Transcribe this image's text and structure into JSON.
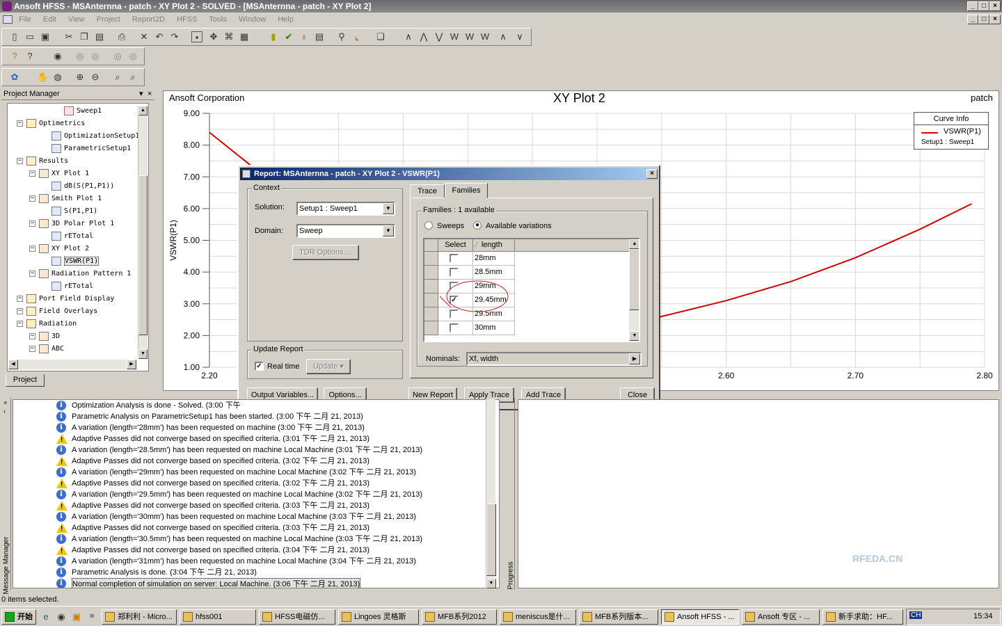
{
  "window": {
    "title": "Ansoft HFSS - MSAnternna - patch - XY Plot 2 - SOLVED - [MSAnternna - patch - XY Plot 2]"
  },
  "menu": [
    "File",
    "Edit",
    "View",
    "Project",
    "Report2D",
    "HFSS",
    "Tools",
    "Window",
    "Help"
  ],
  "project_manager": {
    "title": "Project Manager",
    "tab": "Project",
    "tree": [
      {
        "label": "Sweep1",
        "depth": 4
      },
      {
        "label": "Optimetrics",
        "depth": 1
      },
      {
        "label": "OptimizationSetup1",
        "depth": 3
      },
      {
        "label": "ParametricSetup1",
        "depth": 3
      },
      {
        "label": "Results",
        "depth": 1
      },
      {
        "label": "XY Plot 1",
        "depth": 2
      },
      {
        "label": "dB(S(P1,P1))",
        "depth": 3
      },
      {
        "label": "Smith Plot 1",
        "depth": 2
      },
      {
        "label": "S(P1,P1)",
        "depth": 3
      },
      {
        "label": "3D Polar Plot 1",
        "depth": 2
      },
      {
        "label": "rETotal",
        "depth": 3
      },
      {
        "label": "XY Plot 2",
        "depth": 2
      },
      {
        "label": "VSWR(P1)",
        "depth": 3
      },
      {
        "label": "Radiation Pattern 1",
        "depth": 2
      },
      {
        "label": "rETotal",
        "depth": 3
      },
      {
        "label": "Port Field Display",
        "depth": 1
      },
      {
        "label": "Field Overlays",
        "depth": 1
      },
      {
        "label": "Radiation",
        "depth": 1
      },
      {
        "label": "3D",
        "depth": 2
      },
      {
        "label": "ABC",
        "depth": 2
      }
    ]
  },
  "plot": {
    "corp": "Ansoft Corporation",
    "title": "XY Plot 2",
    "design": "patch",
    "legend": {
      "header": "Curve Info",
      "trace": "VSWR(P1)",
      "setup": "Setup1 : Sweep1"
    }
  },
  "chart_data": {
    "type": "line",
    "ylabel": "VSWR(P1)",
    "xlim": [
      2.2,
      2.8
    ],
    "ylim": [
      1.0,
      9.0
    ],
    "x_ticks": [
      "2.20",
      "2.60",
      "2.70",
      "2.80"
    ],
    "y_ticks": [
      "9.00",
      "8.00",
      "7.00",
      "6.00",
      "5.00",
      "4.00",
      "3.00",
      "2.00",
      "1.00"
    ],
    "grid": true,
    "legend_position": "top-right",
    "series": [
      {
        "name": "VSWR(P1)",
        "color": "#cc0000",
        "x": [
          2.2,
          2.22,
          2.24,
          2.25,
          2.53,
          2.55,
          2.6,
          2.65,
          2.7,
          2.75,
          2.79
        ],
        "y": [
          8.4,
          7.75,
          7.1,
          6.8,
          2.35,
          2.6,
          3.1,
          3.7,
          4.45,
          5.35,
          6.15
        ]
      }
    ]
  },
  "dialog": {
    "title": "Report: MSAnternna - patch - XY Plot 2 - VSWR(P1)",
    "context_label": "Context",
    "solution_label": "Solution:",
    "solution_value": "Setup1 : Sweep1",
    "domain_label": "Domain:",
    "domain_value": "Sweep",
    "tdr_button": "TDR Options ...",
    "update_label": "Update Report",
    "realtime_label": "Real time",
    "update_button": "Update",
    "tabs": [
      "Trace",
      "Families"
    ],
    "families_label": "Families : 1 available",
    "sweeps_label": "Sweeps",
    "variations_label": "Available variations",
    "col_select": "Select",
    "col_length": "length",
    "rows": [
      {
        "value": "28mm",
        "checked": false
      },
      {
        "value": "28.5mm",
        "checked": false
      },
      {
        "value": "29mm",
        "checked": false
      },
      {
        "value": "29.45mm",
        "checked": true
      },
      {
        "value": "29.5mm",
        "checked": false
      },
      {
        "value": "30mm",
        "checked": false
      }
    ],
    "nominals_label": "Nominals:",
    "nominals_value": "Xf, width",
    "buttons": {
      "output_vars": "Output Variables...",
      "options": "Options...",
      "new_report": "New Report",
      "apply_trace": "Apply Trace",
      "add_trace": "Add Trace",
      "close": "Close"
    }
  },
  "messages": {
    "side_label": "Message Manager",
    "progress_label": "Progress",
    "rows": [
      {
        "type": "info",
        "text": "Optimization Analysis is done - Solved. (3:00 下午"
      },
      {
        "type": "info",
        "text": "Parametric Analysis on ParametricSetup1 has been started. (3:00 下午  二月 21, 2013)"
      },
      {
        "type": "info",
        "text": "A variation (length='28mm') has been requested on machine  (3:00 下午  二月 21, 2013)"
      },
      {
        "type": "warn",
        "text": "Adaptive Passes did not converge based on specified criteria. (3:01 下午  二月 21, 2013)"
      },
      {
        "type": "info",
        "text": "A variation (length='28.5mm') has been requested on machine Local Machine (3:01 下午  二月 21, 2013)"
      },
      {
        "type": "warn",
        "text": "Adaptive Passes did not converge based on specified criteria. (3:02 下午  二月 21, 2013)"
      },
      {
        "type": "info",
        "text": "A variation (length='29mm') has been requested on machine Local Machine (3:02 下午  二月 21, 2013)"
      },
      {
        "type": "warn",
        "text": "Adaptive Passes did not converge based on specified criteria. (3:02 下午  二月 21, 2013)"
      },
      {
        "type": "info",
        "text": "A variation (length='29.5mm') has been requested on machine Local Machine (3:02 下午  二月 21, 2013)"
      },
      {
        "type": "warn",
        "text": "Adaptive Passes did not converge based on specified criteria. (3:03 下午  二月 21, 2013)"
      },
      {
        "type": "info",
        "text": "A variation (length='30mm') has been requested on machine Local Machine (3:03 下午  二月 21, 2013)"
      },
      {
        "type": "warn",
        "text": "Adaptive Passes did not converge based on specified criteria. (3:03 下午  二月 21, 2013)"
      },
      {
        "type": "info",
        "text": "A variation (length='30.5mm') has been requested on machine Local Machine (3:03 下午  二月 21, 2013)"
      },
      {
        "type": "warn",
        "text": "Adaptive Passes did not converge based on specified criteria. (3:04 下午  二月 21, 2013)"
      },
      {
        "type": "info",
        "text": "A variation (length='31mm') has been requested on machine Local Machine (3:04 下午  二月 21, 2013)"
      },
      {
        "type": "info",
        "text": "Parametric Analysis is done. (3:04 下午  二月 21, 2013)"
      },
      {
        "type": "info",
        "text": "Normal completion of simulation on server: Local Machine. (3:06 下午  二月 21, 2013)"
      }
    ]
  },
  "status": "0 items selected.",
  "taskbar": {
    "start": "开始",
    "tasks": [
      "郑利利 - Micro...",
      "hfss001",
      "HFSS电磁仿...",
      "Lingoes 灵格斯",
      "MFB系列2012",
      "meniscus是什...",
      "MFB系列版本...",
      "Ansoft HFSS - ...",
      "Ansoft 专区 - ...",
      "新手求助：HF..."
    ],
    "lang": "CH",
    "clock": "15:34"
  },
  "watermark": "RFEDA.CN"
}
